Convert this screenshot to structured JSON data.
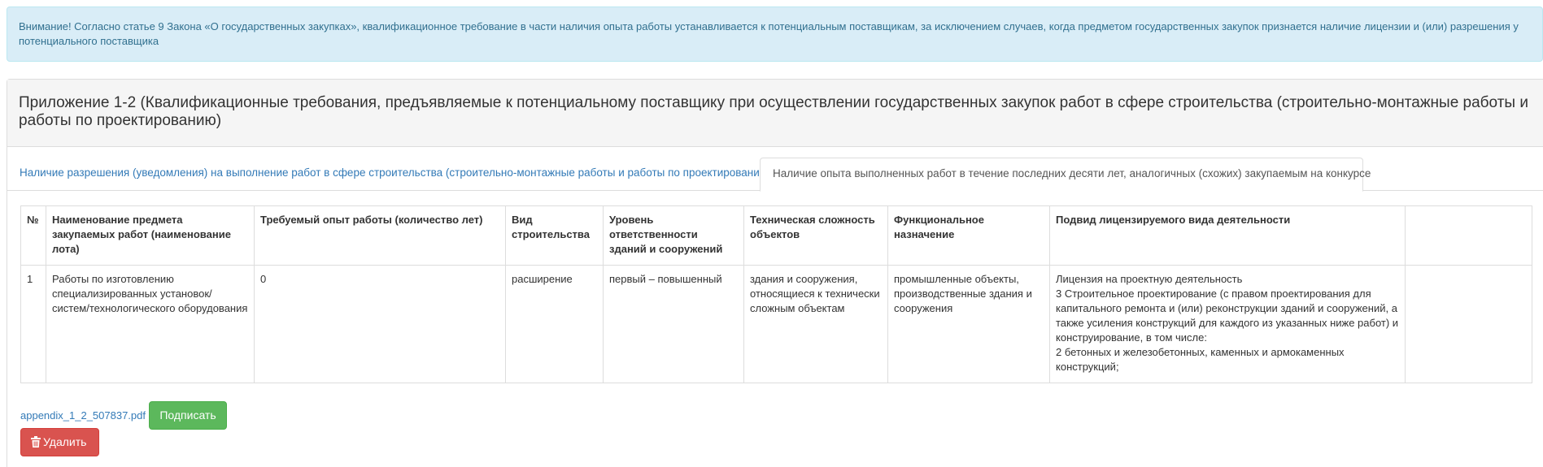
{
  "alert": {
    "text": "Внимание! Согласно статье 9 Закона «О государственных закупках», квалификационное требование в части наличия опыта работы устанавливается к потенциальным поставщикам, за исключением случаев, когда предметом государственных закупок признается наличие лицензии и (или) разрешения у потенциального поставщика"
  },
  "panel": {
    "title": "Приложение 1-2 (Квалификационные требования, предъявляемые к потенциальному поставщику при осуществлении государственных закупок работ в сфере строительства (строительно-монтажные работы и работы по проектированию)"
  },
  "tabs": [
    {
      "label": "Наличие разрешения (уведомления) на выполнение работ в сфере строительства (строительно-монтажные работы и работы по проектированию)",
      "active": false
    },
    {
      "label": "Наличие опыта выполненных работ в течение последних десяти лет, аналогичных (схожих) закупаемым на конкурсе",
      "active": true
    }
  ],
  "table": {
    "headers": [
      "№",
      "Наименование предмета закупаемых работ (наименование лота)",
      "Требуемый опыт работы (количество лет)",
      "Вид строительства",
      "Уровень ответственности зданий и сооружений",
      "Техническая сложность объектов",
      "Функциональное назначение",
      "Подвид лицензируемого вида деятельности",
      ""
    ],
    "rows": [
      [
        "1",
        "Работы по изготовлению специализированных установок/систем/технологического оборудования",
        "0",
        "расширение",
        "первый – повышенный",
        "здания и сооружения, относящиеся к технически сложным объектам",
        "промышленные объекты, производственные здания и сооружения",
        "Лицензия на проектную деятельность\n3 Строительное проектирование (с правом проектирования для капитального ремонта и (или) реконструкции зданий и сооружений, а также усиления конструкций для каждого из указанных ниже работ) и конструирование, в том числе:\n2 бетонных и железобетонных, каменных и армокаменных конструкций;",
        ""
      ]
    ]
  },
  "file": {
    "name": "appendix_1_2_507837.pdf",
    "sign_label": "Подписать",
    "delete_label": "Удалить"
  },
  "colors": {
    "link": "#337ab7",
    "success": "#5cb85c",
    "danger": "#d9534f",
    "info_bg": "#d9edf7"
  }
}
